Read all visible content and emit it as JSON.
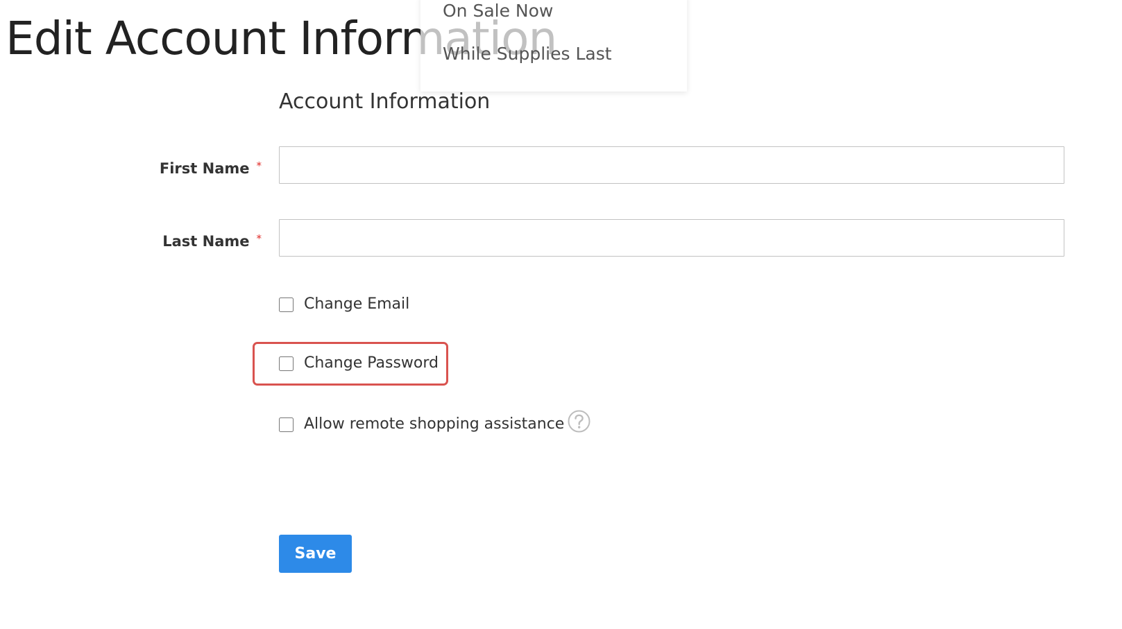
{
  "page": {
    "title": "Edit Account Information"
  },
  "dropdown": {
    "items": [
      {
        "label": "On Sale Now"
      },
      {
        "label": "While Supplies Last"
      }
    ]
  },
  "form": {
    "section_title": "Account Information",
    "first_name": {
      "label": "First Name",
      "required_mark": "*",
      "value": ""
    },
    "last_name": {
      "label": "Last Name",
      "required_mark": "*",
      "value": ""
    },
    "checkboxes": [
      {
        "label": "Change Email",
        "checked": false
      },
      {
        "label": "Change Password",
        "checked": false,
        "highlighted": true
      },
      {
        "label": "Allow remote shopping assistance",
        "checked": false
      }
    ],
    "help_icon": "question-circle-icon",
    "save_label": "Save"
  },
  "colors": {
    "accent_button": "#2d8ae8",
    "required": "#e02b27",
    "highlight": "#d9534f"
  }
}
